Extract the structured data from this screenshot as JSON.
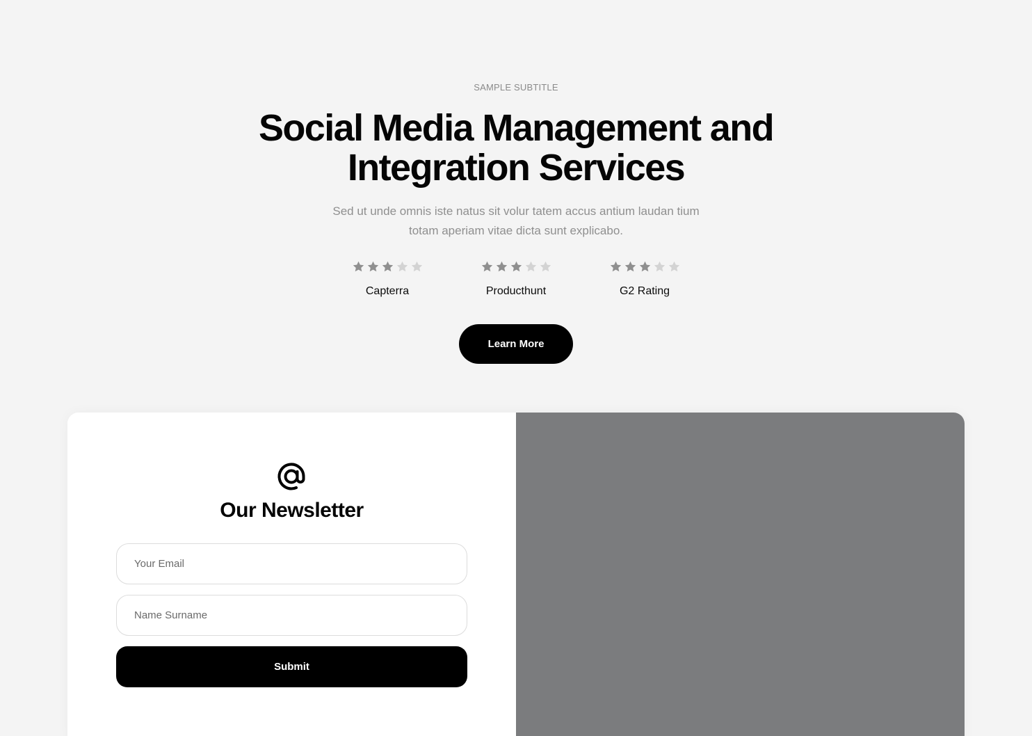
{
  "hero": {
    "subtitle": "SAMPLE SUBTITLE",
    "title_line1": "Social Media Management and",
    "title_line2": "Integration Services",
    "description_line1": "Sed ut unde omnis iste natus sit volur tatem accus antium laudan tium",
    "description_line2": "totam aperiam vitae dicta sunt explicabo.",
    "button_label": "Learn More"
  },
  "ratings": [
    {
      "label": "Capterra",
      "stars_filled": 3,
      "stars_total": 5
    },
    {
      "label": "Producthunt",
      "stars_filled": 3,
      "stars_total": 5
    },
    {
      "label": "G2 Rating",
      "stars_filled": 3,
      "stars_total": 5
    }
  ],
  "newsletter": {
    "icon": "at-sign-icon",
    "title": "Our Newsletter",
    "email_placeholder": "Your Email",
    "name_placeholder": "Name Surname",
    "submit_label": "Submit"
  },
  "colors": {
    "background": "#f4f4f4",
    "star_filled": "#8f8f8f",
    "star_empty": "#d3d3d3",
    "image_placeholder": "#7b7c7e",
    "button": "#000000"
  }
}
